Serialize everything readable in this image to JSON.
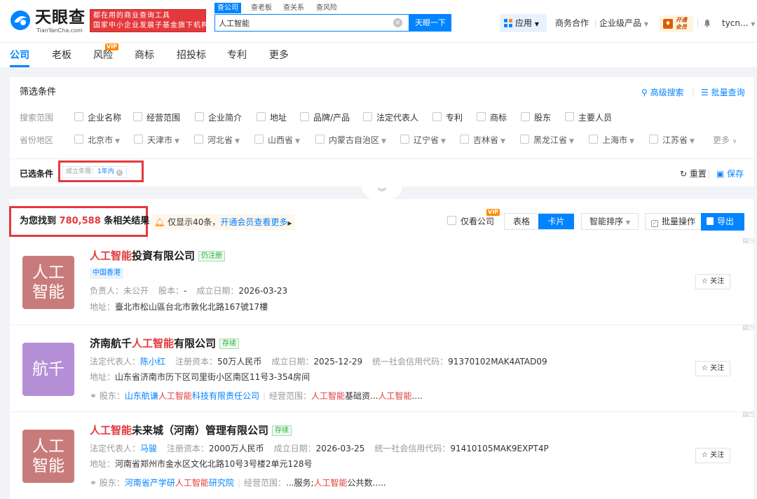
{
  "header": {
    "logo_cn": "天眼查",
    "logo_en": "TianYanCha.com",
    "slogan_line1": "都在用的商业查询工具",
    "slogan_line2": "国家中小企业发展子基金旗下机构",
    "search_tabs": [
      "查公司",
      "查老板",
      "查关系",
      "查风险"
    ],
    "search_value": "人工智能",
    "search_button": "天眼一下",
    "app_label": "应用",
    "links": [
      "商务合作",
      "企业级产品"
    ],
    "vip_label_line1": "开通",
    "vip_label_line2": "会员",
    "user": "tycn..."
  },
  "nav": {
    "tabs": [
      "公司",
      "老板",
      "风险",
      "商标",
      "招投标",
      "专利",
      "更多"
    ],
    "vip_badge": "VIP",
    "active": "公司"
  },
  "filter": {
    "title": "筛选条件",
    "advanced_search": "高级搜索",
    "batch_query": "批量查询",
    "scope_label": "搜索范围",
    "scope_options": [
      "企业名称",
      "经营范围",
      "企业简介",
      "地址",
      "品牌/产品",
      "法定代表人",
      "专利",
      "商标",
      "股东",
      "主要人员"
    ],
    "region_label": "省份地区",
    "regions": [
      "北京市",
      "天津市",
      "河北省",
      "山西省",
      "内蒙古自治区",
      "辽宁省",
      "吉林省",
      "黑龙江省",
      "上海市",
      "江苏省"
    ],
    "more": "更多",
    "selected_label": "已选条件",
    "chip_key": "成立年限：",
    "chip_value": "1年内",
    "reset": "重置",
    "save": "保存"
  },
  "results": {
    "count_prefix": "为您找到",
    "count": "780,588",
    "count_suffix": "条相关结果",
    "notice_text": "仅显示40条，",
    "notice_link": "开通会员查看更多",
    "only_company": "仅看公司",
    "vip_badge": "VIP",
    "view_table": "表格",
    "view_card": "卡片",
    "sort": "智能排序",
    "batch": "批量操作",
    "export": "导出",
    "follow_label": "关注"
  },
  "companies": [
    {
      "logo_line1": "人工",
      "logo_line2": "智能",
      "logo_color": "#c97b7b",
      "name_hl": "人工智能",
      "name_rest": "投資有限公司",
      "status": "仍注册",
      "region": "中国香港",
      "rep_label": "负责人：",
      "rep_value": "未公开",
      "capital_label": "股本：",
      "capital_value": "-",
      "date_label": "成立日期：",
      "date_value": "2026-03-23",
      "address_label": "地址：",
      "address": "臺北市松山區台北市敦化北路167號17樓"
    },
    {
      "logo_line1": "航千",
      "logo_color": "#b58fd6",
      "name_pre": "济南航千",
      "name_hl": "人工智能",
      "name_rest": "有限公司",
      "status": "存续",
      "rep_label": "法定代表人：",
      "rep_value": "陈小红",
      "capital_label": "注册资本：",
      "capital_value": "50万人民币",
      "date_label": "成立日期：",
      "date_value": "2025-12-29",
      "credit_label": "统一社会信用代码：",
      "credit_value": "91370102MAK4ATAD09",
      "address_label": "地址：",
      "address": "山东省济南市历下区司里街小区南区11号3-354房间",
      "shareholder_label": "股东：",
      "shareholder_pre": "山东航谦",
      "shareholder_hl": "人工智能",
      "shareholder_post": "科技有限责任公司",
      "scope_label": "经营范围：",
      "scope_hl1": "人工智能",
      "scope_mid": "基础资...",
      "scope_hl2": "人工智能",
      "scope_post": "...."
    },
    {
      "logo_line1": "人工",
      "logo_line2": "智能",
      "logo_color": "#c97b7b",
      "name_hl": "人工智能",
      "name_rest": "未来城（河南）管理有限公司",
      "status": "存续",
      "rep_label": "法定代表人：",
      "rep_value": "马骏",
      "capital_label": "注册资本：",
      "capital_value": "2000万人民币",
      "date_label": "成立日期：",
      "date_value": "2026-03-25",
      "credit_label": "统一社会信用代码：",
      "credit_value": "91410105MAK9EXPT4P",
      "address_label": "地址：",
      "address": "河南省郑州市金水区文化北路10号3号楼2单元128号",
      "shareholder_label": "股东：",
      "shareholder_pre": "河南省产学研",
      "shareholder_hl": "人工智能",
      "shareholder_post": "研究院",
      "scope_label": "经营范围：",
      "scope_pre": "...服务;",
      "scope_hl1": "人工智能",
      "scope_post": "公共数....."
    }
  ]
}
